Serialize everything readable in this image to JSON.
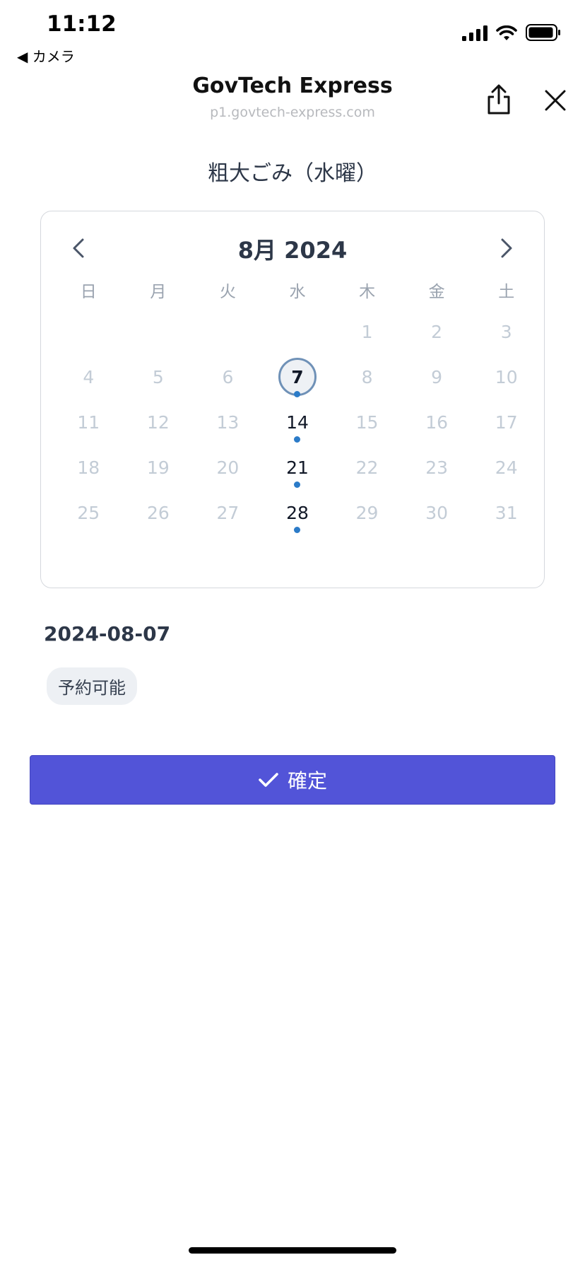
{
  "status_bar": {
    "time": "11:12",
    "back_label": "◀ カメラ",
    "icons": [
      "cellular-signal-icon",
      "wifi-icon",
      "battery-icon"
    ]
  },
  "header": {
    "title": "GovTech Express",
    "url": "p1.govtech-express.com",
    "icons": [
      "share-icon",
      "close-icon"
    ]
  },
  "page": {
    "title": "粗大ごみ（水曜）"
  },
  "calendar": {
    "month_label": "8月 2024",
    "weekdays": [
      "日",
      "月",
      "火",
      "水",
      "木",
      "金",
      "土"
    ],
    "leading_blanks": 4,
    "days": [
      "1",
      "2",
      "3",
      "4",
      "5",
      "6",
      "7",
      "8",
      "9",
      "10",
      "11",
      "12",
      "13",
      "14",
      "15",
      "16",
      "17",
      "18",
      "19",
      "20",
      "21",
      "22",
      "23",
      "24",
      "25",
      "26",
      "27",
      "28",
      "29",
      "30",
      "31"
    ],
    "available_days": [
      "7",
      "14",
      "21",
      "28"
    ],
    "selected_day": "7"
  },
  "selection": {
    "date": "2024-08-07",
    "status": "予約可能"
  },
  "confirm_button": {
    "label": "確定"
  },
  "colors": {
    "accent": "#5254d8",
    "dot": "#2b7bc8",
    "selected_ring": "#6f91b7",
    "disabled_day": "#c3ccd6"
  }
}
